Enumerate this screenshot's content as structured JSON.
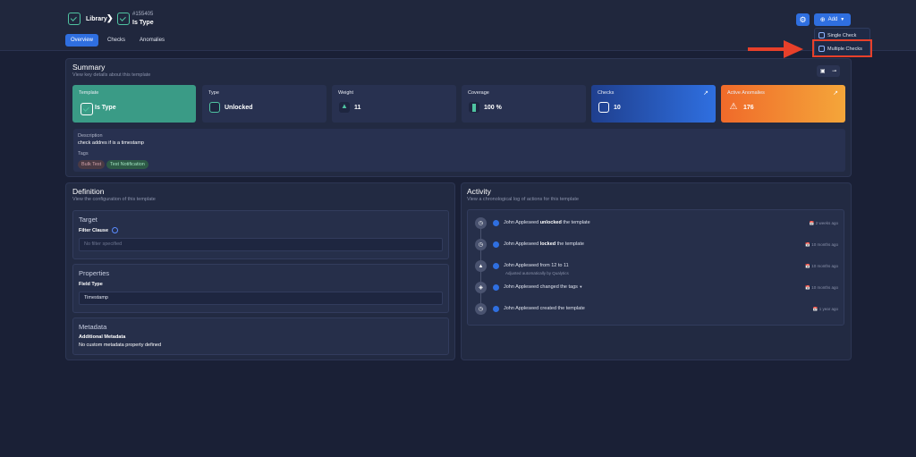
{
  "breadcrumb": {
    "library": "Library",
    "item_id": "#155405",
    "item_title": "Is Type"
  },
  "tabs": [
    "Overview",
    "Checks",
    "Anomalies"
  ],
  "header": {
    "add_label": "Add"
  },
  "dropdown": {
    "items": [
      "Single Check",
      "Multiple Checks"
    ]
  },
  "summary": {
    "title": "Summary",
    "subtitle": "View key details about this template",
    "cards": [
      {
        "label": "Template",
        "value": "Is Type",
        "color": "#3a9b86"
      },
      {
        "label": "Type",
        "value": "Unlocked"
      },
      {
        "label": "Weight",
        "value": "11"
      },
      {
        "label": "Coverage",
        "value": "100 %"
      },
      {
        "label": "Checks",
        "value": "10",
        "color": "#2f6fe0"
      },
      {
        "label": "Active Anomalies",
        "value": "176",
        "color": "#f0802a"
      }
    ],
    "description_label": "Description",
    "description": "check addres if is a timestamp",
    "tags_label": "Tags",
    "tags": [
      "Bulk Test",
      "Test Notification"
    ]
  },
  "definition": {
    "title": "Definition",
    "subtitle": "View the configuration of this template",
    "target_title": "Target",
    "filter_label": "Filter Clause",
    "filter_placeholder": "No filter specified",
    "properties_title": "Properties",
    "field_type_label": "Field Type",
    "field_type_value": "Timestamp",
    "metadata_title": "Metadata",
    "additional_metadata_label": "Additional Metadata",
    "additional_metadata_value": "No custom metadata property defined"
  },
  "activity": {
    "title": "Activity",
    "subtitle": "View a chronological log of actions for this template",
    "items": [
      {
        "actor": "John Appleseed",
        "action": "unlocked",
        "suffix": "the template",
        "time": "2 weeks ago"
      },
      {
        "actor": "John Appleseed",
        "action": "locked",
        "suffix": "the template",
        "time": "10 months ago"
      },
      {
        "text": "John Appleseed from 12 to 11",
        "sub": "Adjusted automatically by Qualytics",
        "time": "10 months ago"
      },
      {
        "text": "John Appleseed changed the tags",
        "time": "10 months ago"
      },
      {
        "text": "John Appleseed created the template",
        "time": "1 year ago"
      }
    ]
  }
}
